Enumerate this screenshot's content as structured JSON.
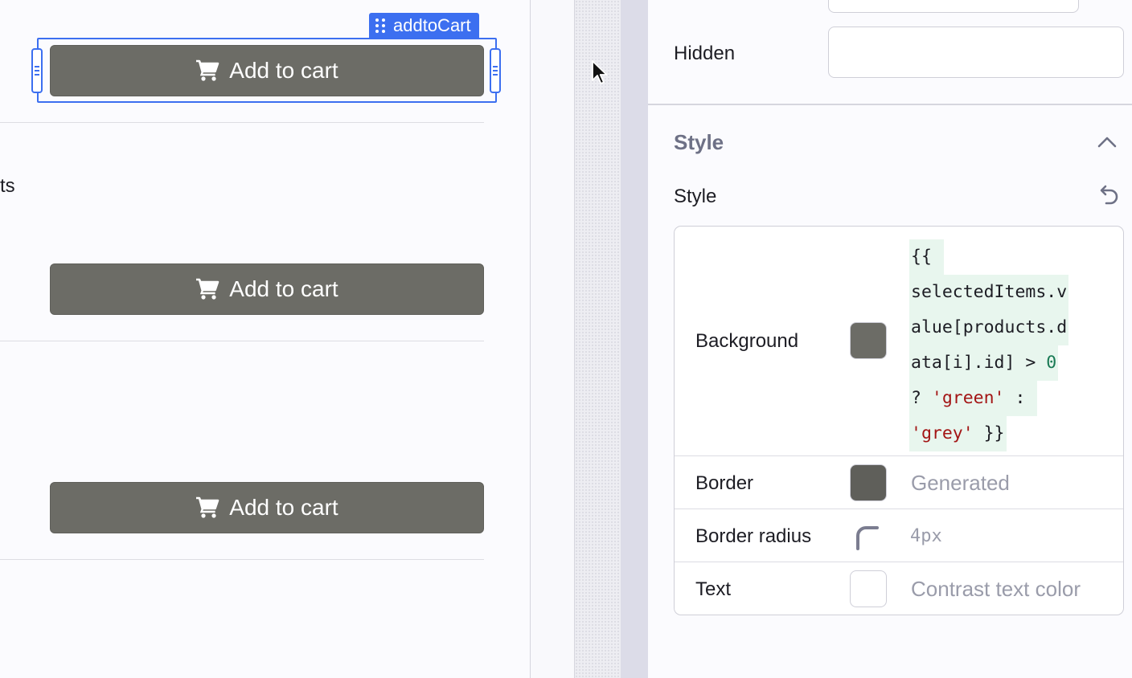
{
  "canvas": {
    "selected_component": "addtoCart",
    "partial_text": "ts",
    "buttons": [
      {
        "label": "Add to cart"
      },
      {
        "label": "Add to cart"
      },
      {
        "label": "Add to cart"
      }
    ],
    "button_icon": "shopping-cart-icon"
  },
  "inspector": {
    "hidden": {
      "label": "Hidden",
      "value": ""
    },
    "style_section": {
      "title": "Style",
      "expanded": true,
      "toggle_icon": "chevron-up-icon"
    },
    "style_group": {
      "label": "Style",
      "reset_icon": "reset-icon"
    },
    "rows": {
      "background": {
        "label": "Background",
        "swatch_color": "#6c6c66",
        "code_lines": [
          "{{ ",
          "selectedItems.v",
          "alue[products.d",
          "ata[i].id] > ",
          "? ",
          "'grey'"
        ],
        "code_num": "0",
        "code_str_green": "'green'",
        "code_colon": " : ",
        "code_close": " }}"
      },
      "border": {
        "label": "Border",
        "swatch_color": "#5f5f5a",
        "value": "Generated"
      },
      "border_radius": {
        "label": "Border radius",
        "value": "4px"
      },
      "text": {
        "label": "Text",
        "swatch_color": "#ffffff",
        "value": "Contrast text color"
      }
    }
  },
  "colors": {
    "selection": "#3c6ff0",
    "button_bg": "#6c6c66"
  }
}
